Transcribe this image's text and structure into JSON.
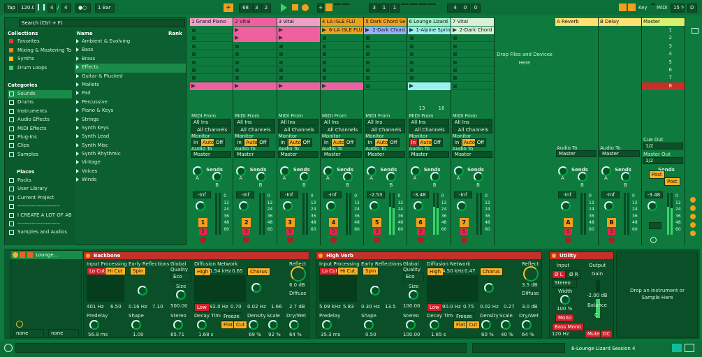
{
  "transport": {
    "tap": "Tap",
    "tempo": "120.00",
    "time_sig_num": "4",
    "time_sig_den": "4",
    "metronome": "●○",
    "quant": "1 Bar",
    "pos_bar": "68",
    "pos_beat": "3",
    "pos_sixteenth": "2",
    "loop_bar": "3",
    "loop_beat": "1",
    "loop_sixteenth": "1",
    "len_bar": "4",
    "len_beat": "0",
    "len_sixteenth": "0",
    "key_label": "Key",
    "midi_label": "MIDI",
    "cpu": "15 %",
    "disk": "D"
  },
  "browser": {
    "search_placeholder": "Search (Ctrl + F)",
    "collections_title": "Collections",
    "collections": [
      {
        "label": "Favorites",
        "color": "#e23a3a"
      },
      {
        "label": "Mixing & Mastering To",
        "color": "#f08a20"
      },
      {
        "label": "Synths",
        "color": "#f0c020"
      },
      {
        "label": "Drum Loops",
        "color": "#3bd46a"
      }
    ],
    "categories_title": "Categories",
    "categories": [
      "Sounds",
      "Drums",
      "Instruments",
      "Audio Effects",
      "MIDI Effects",
      "Plug-Ins",
      "Clips",
      "Samples"
    ],
    "places_title": "Places",
    "places": [
      "Packs",
      "User Library",
      "Current Project",
      "------------------------",
      "I CREATE A LOT OF ABL",
      "------------------------",
      "Samples and Audios"
    ],
    "col_name": "Name",
    "col_rank": "Rank",
    "items": [
      "Ambient & Evolving",
      "Bass",
      "Brass",
      "Effects",
      "Guitar & Plucked",
      "Mallets",
      "Pad",
      "Percussive",
      "Piano & Keys",
      "Strings",
      "Synth Keys",
      "Synth Lead",
      "Synth Misc",
      "Synth Rhythmic",
      "Vintage",
      "Voices",
      "Winds"
    ],
    "selected_item": "Effects"
  },
  "tracks": [
    {
      "name": "1 Grand Piano",
      "color": "#f0a0c8",
      "num": "1",
      "vol": "-Inf",
      "clip": "",
      "clipColor": "#f060a0"
    },
    {
      "name": "2 Vital",
      "color": "#f060a0",
      "num": "2",
      "vol": "-Inf",
      "clip": "",
      "clipColor": "#f060a0"
    },
    {
      "name": "3 Vital",
      "color": "#f0a0c8",
      "num": "3",
      "vol": "-Inf",
      "clip": "",
      "clipColor": "#f060a0"
    },
    {
      "name": "4 LA ISLE FLU",
      "color": "#f0a020",
      "num": "4",
      "vol": "-Inf",
      "clip": "6-LA ISLE FLU",
      "clipColor": "#f0a020"
    },
    {
      "name": "5 Dark Chord Se",
      "color": "#f0a020",
      "num": "5",
      "vol": "-2.53",
      "clip": "2-Dark Chord S",
      "clipColor": "#9ab0ff"
    },
    {
      "name": "6 Lounge Lizard",
      "color": "#9ef0c8",
      "num": "6",
      "vol": "-3.48",
      "clip": "1-Alpine Spring",
      "clipColor": "#9ef0f0"
    },
    {
      "name": "7 Vital",
      "color": "#d8f0d8",
      "num": "7",
      "vol": "-Inf",
      "clip": "2-Dark Chord S",
      "clipColor": "#d8f0d8"
    }
  ],
  "returns": [
    {
      "name": "A Reverb",
      "color": "#ffe070",
      "num": "A",
      "vol": "-Inf"
    },
    {
      "name": "B Delay",
      "color": "#ffe070",
      "num": "B",
      "vol": "-Inf"
    },
    {
      "name": "Master",
      "color": "#d8f070",
      "vol": "-3.48"
    }
  ],
  "scene_numbers": [
    "1",
    "2",
    "3",
    "4",
    "5",
    "6",
    "7",
    "8"
  ],
  "drop_files": "Drop Files and Devices Here",
  "io": {
    "midi_from": "MIDI From",
    "all_ins": "All Ins",
    "all_channels": "All Channels",
    "monitor": "Monitor",
    "in": "In",
    "auto": "Auto",
    "off": "Off",
    "audio_to": "Audio To",
    "master": "Master",
    "sends": "Sends",
    "cue_out": "Cue Out",
    "cue_val": "1/2",
    "master_out": "Master Out",
    "master_val": "1/2",
    "post": "Post",
    "clip_stats_a": "13",
    "clip_stats_b": "16"
  },
  "meter_scale": [
    "0",
    "12",
    "24",
    "36",
    "48",
    "60"
  ],
  "devices": {
    "chain_name": "Lounge...",
    "chain_in": "none",
    "chain_out": "none",
    "backbone": {
      "title": "Backbone",
      "input_proc": "Input Processing",
      "lo_cut": "Lo Cut",
      "hi_cut": "Hi Cut",
      "early_refl": "Early Reflections",
      "spin": "Spin",
      "global": "Global",
      "quality": "Quality",
      "eco": "Eco",
      "size_label": "Size",
      "size_val": "500.00",
      "diffusion": "Diffusion Network",
      "high": "High",
      "high_freq": "1.54 kHz",
      "high_val": "0.65",
      "chorus": "Chorus",
      "reflect": "Reflect",
      "reflect_val": "6.0 dB",
      "diffuse": "Diffuse",
      "diffuse_val": "2.7 dB",
      "f1": "401 Hz",
      "f2": "6.50",
      "s1": "0.16 Hz",
      "s2": "7.10",
      "low": "Low",
      "low_freq": "92.0 Hz",
      "low_val": "0.70",
      "ch1": "0.02 Hz",
      "ch2": "1.66",
      "predelay": "Predelay",
      "predelay_val": "56.9 ms",
      "shape": "Shape",
      "shape_val": "1.00",
      "stereo": "Stereo",
      "stereo_val": "85.71",
      "decay": "Decay Time",
      "decay_val": "1.68 s",
      "freeze": "Freeze",
      "flat": "Flat",
      "cut": "Cut",
      "density": "Density",
      "density_val": "69 %",
      "scale": "Scale",
      "scale_val": "92 %",
      "drywet": "Dry/Wet",
      "drywet_val": "64 %"
    },
    "highverb": {
      "title": "High Verb",
      "input_proc": "Input Processing",
      "lo_cut": "Lo Cut",
      "hi_cut": "Hi Cut",
      "early_refl": "Early Reflections",
      "spin": "Spin",
      "global": "Global",
      "quality": "Quality",
      "eco": "Eco",
      "size_label": "Size",
      "size_val": "100.00",
      "diffusion": "Diffusion Network",
      "high": "High",
      "high_freq": "4.50 kHz",
      "high_val": "0.47",
      "chorus": "Chorus",
      "reflect": "Reflect",
      "reflect_val": "3.5 dB",
      "diffuse": "Diffuse",
      "diffuse_val": "3.0 dB",
      "f1": "5.09 kHz",
      "f2": "5.83",
      "s1": "0.30 Hz",
      "s2": "13.5",
      "low": "Low",
      "low_freq": "90.0 Hz",
      "low_val": "0.75",
      "ch1": "0.02 Hz",
      "ch2": "0.27",
      "predelay": "Predelay",
      "predelay_val": "35.3 ms",
      "shape": "Shape",
      "shape_val": "0.50",
      "stereo": "Stereo",
      "stereo_val": "100.00",
      "decay": "Decay Time",
      "decay_val": "1.65 s",
      "freeze": "Freeze",
      "flat": "Flat",
      "cut": "Cut",
      "density": "Density",
      "density_val": "60 %",
      "scale": "Scale",
      "scale_val": "40 %",
      "drywet": "Dry/Wet",
      "drywet_val": "64 %"
    },
    "utility": {
      "title": "Utility",
      "input": "Input",
      "phase_l": "Ø L",
      "phase_r": "Ø R",
      "output": "Output",
      "gain": "Gain",
      "stereo_mode": "Stereo",
      "width": "Width",
      "width_val": "100 %",
      "mono": "Mono",
      "gain_val": "-2.00 dB",
      "balance": "Balance",
      "balance_val": "C",
      "bass_mono": "Bass Mono",
      "bass_freq": "120 Hz",
      "mute": "Mute",
      "dc": "DC"
    },
    "drop_instrument": "Drop an Instrument or Sample Here"
  },
  "status": {
    "session_name": "6-Lounge Lizard Session 4"
  }
}
